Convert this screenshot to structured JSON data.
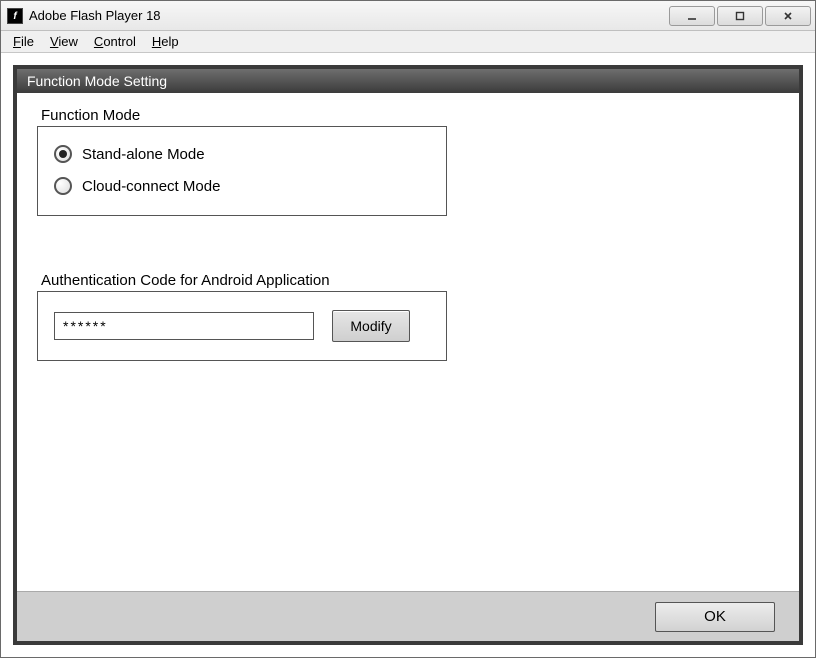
{
  "titlebar": {
    "app_icon_glyph": "f",
    "title": "Adobe Flash Player 18"
  },
  "menubar": {
    "items": [
      {
        "mn": "F",
        "rest": "ile"
      },
      {
        "mn": "V",
        "rest": "iew"
      },
      {
        "mn": "C",
        "rest": "ontrol"
      },
      {
        "mn": "H",
        "rest": "elp"
      }
    ]
  },
  "panel": {
    "header": "Function Mode Setting",
    "function_mode": {
      "label": "Function Mode",
      "options": [
        {
          "label": "Stand-alone Mode",
          "checked": true
        },
        {
          "label": "Cloud-connect Mode",
          "checked": false
        }
      ]
    },
    "auth": {
      "label": "Authentication Code for Android Application",
      "value": "******",
      "modify_label": "Modify"
    },
    "footer": {
      "ok_label": "OK"
    }
  }
}
